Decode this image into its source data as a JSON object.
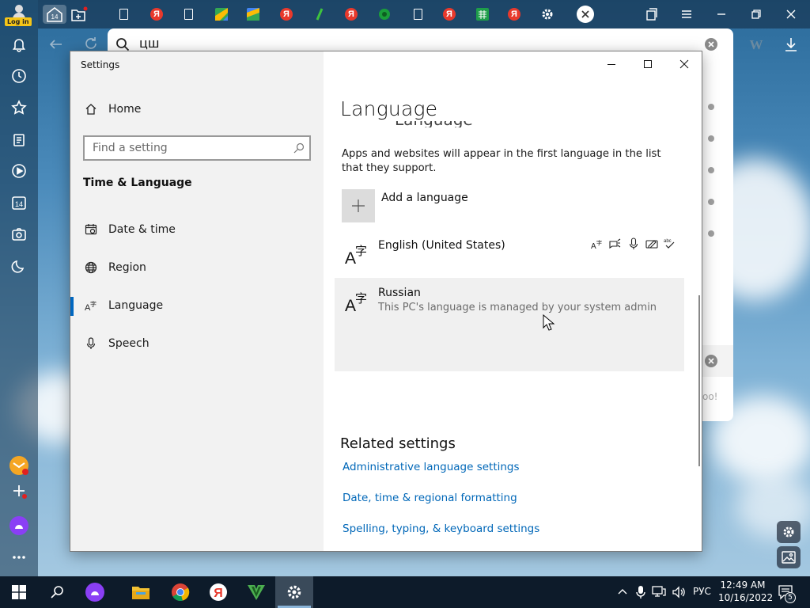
{
  "browser": {
    "login_label": "Log in",
    "badge_count": "14",
    "search_query": "цш",
    "partial_text": "oo!",
    "tab_letter": "Я"
  },
  "settings": {
    "window_title": "Settings",
    "nav": {
      "home": "Home",
      "search_placeholder": "Find a setting",
      "section_title": "Time & Language",
      "items": [
        {
          "label": "Date & time",
          "icon": "clock-icon"
        },
        {
          "label": "Region",
          "icon": "globe-icon"
        },
        {
          "label": "Language",
          "icon": "language-icon",
          "selected": true
        },
        {
          "label": "Speech",
          "icon": "microphone-icon"
        }
      ]
    },
    "page_title": "Language",
    "description": "Apps and websites will appear in the first language in the list that they support.",
    "add_language_label": "Add a language",
    "languages": [
      {
        "name": "English (United States)",
        "features": [
          "display-language-icon",
          "text-to-speech-icon",
          "speech-recognition-icon",
          "handwriting-icon",
          "spellcheck-icon"
        ]
      },
      {
        "name": "Russian",
        "subtitle": "This PC's language is managed by your system admin",
        "selected": true
      }
    ],
    "related_title": "Related settings",
    "related_links": [
      "Administrative language settings",
      "Date, time & regional formatting",
      "Spelling, typing, & keyboard settings"
    ]
  },
  "taskbar": {
    "language": "РУС",
    "time": "12:49 AM",
    "date": "10/16/2022",
    "notification_count": "5"
  },
  "colors": {
    "accent": "#0067b8",
    "taskbar": "#0d1b2a",
    "selection": "#f0f0f0"
  }
}
